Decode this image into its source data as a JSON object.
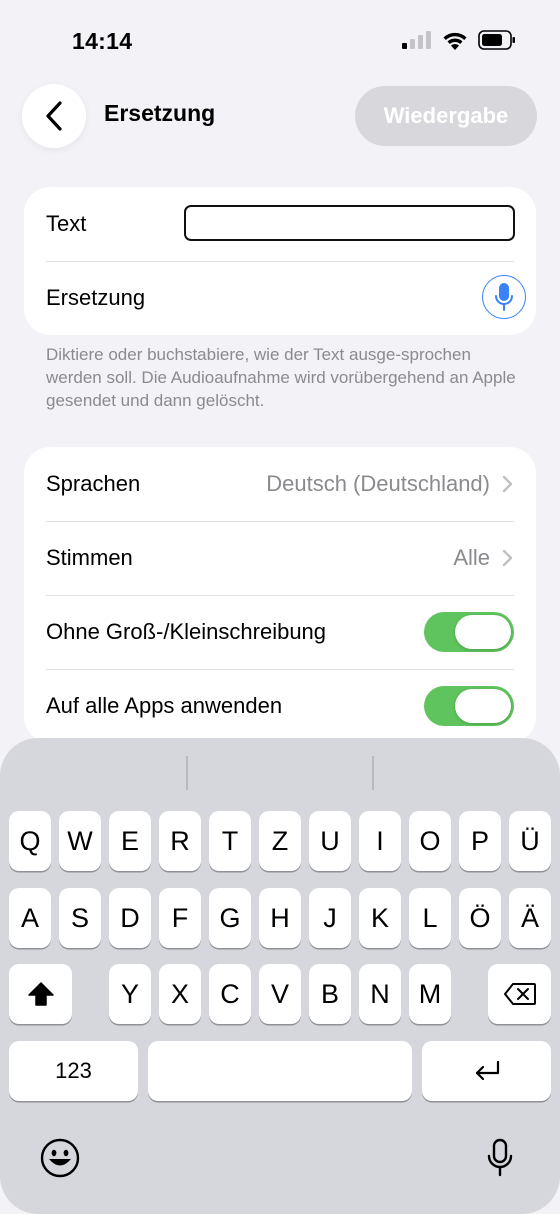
{
  "status": {
    "time": "14:14"
  },
  "nav": {
    "title": "Ersetzung",
    "playback_label": "Wiedergabe"
  },
  "entry": {
    "text_label": "Text",
    "text_value": "",
    "replacement_label": "Ersetzung"
  },
  "footnote": "Diktiere oder buchstabiere, wie der Text ausge-sprochen werden soll. Die Audioaufnahme wird vorübergehend an Apple gesendet und dann gelöscht.",
  "options": {
    "languages_label": "Sprachen",
    "languages_value": "Deutsch (Deutschland)",
    "voices_label": "Stimmen",
    "voices_value": "Alle",
    "case_insensitive_label": "Ohne Groß-/Kleinschreibung",
    "case_insensitive_on": true,
    "all_apps_label": "Auf alle Apps anwenden",
    "all_apps_on": true
  },
  "keyboard": {
    "row1": [
      "Q",
      "W",
      "E",
      "R",
      "T",
      "Z",
      "U",
      "I",
      "O",
      "P",
      "Ü"
    ],
    "row2": [
      "A",
      "S",
      "D",
      "F",
      "G",
      "H",
      "J",
      "K",
      "L",
      "Ö",
      "Ä"
    ],
    "row3": [
      "Y",
      "X",
      "C",
      "V",
      "B",
      "N",
      "M"
    ],
    "numbers_label": "123"
  }
}
